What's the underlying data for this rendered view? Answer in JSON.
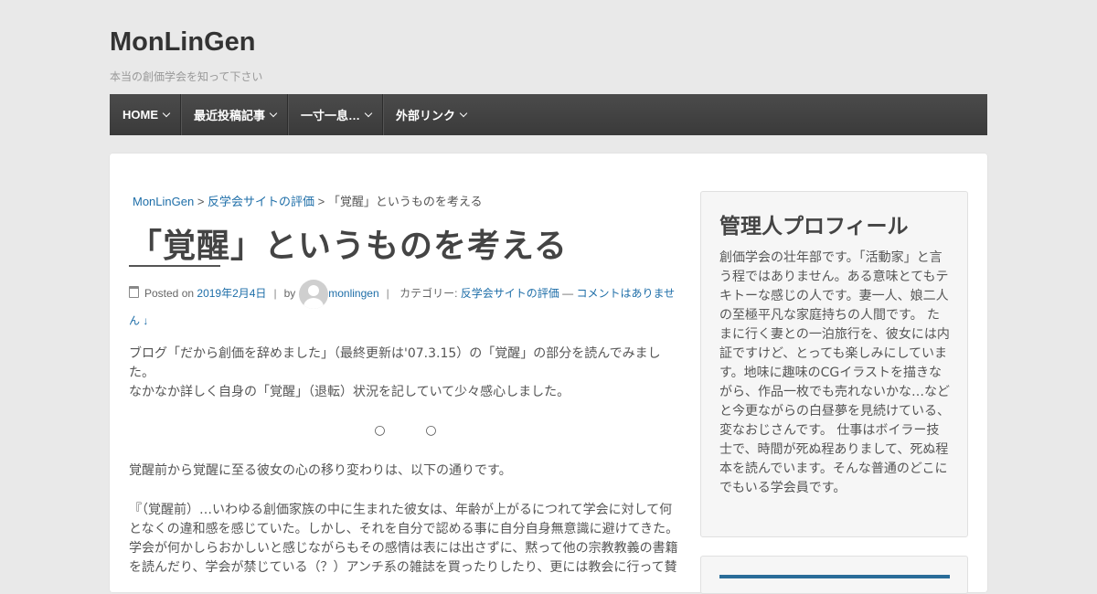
{
  "site": {
    "title": "MonLinGen",
    "tagline": "本当の創価学会を知って下さい"
  },
  "nav": {
    "items": [
      {
        "label": "HOME"
      },
      {
        "label": "最近投稿記事"
      },
      {
        "label": "一寸一息…"
      },
      {
        "label": "外部リンク"
      }
    ]
  },
  "breadcrumb": {
    "home": "MonLinGen",
    "sep1": " > ",
    "category": "反学会サイトの評価",
    "sep2": " > ",
    "current": "「覚醒」というものを考える"
  },
  "post": {
    "title": "「覚醒」というものを考える",
    "posted_on": "Posted on",
    "date": "2019年2月4日",
    "by": "by",
    "author": "monlingen",
    "category_label": "カテゴリー:",
    "category": "反学会サイトの評価",
    "dash": " — ",
    "comments": "コメントはありません ↓",
    "paragraphs": [
      "ブログ「だから創価を辞めました」（最終更新は'07.3.15）の「覚醒」の部分を読んでみました。",
      "なかなか詳しく自身の「覚醒」（退転）状況を記していて少々感心しました。",
      "覚醒前から覚醒に至る彼女の心の移り変わりは、以下の通りです。",
      "『（覚醒前）…いわゆる創価家族の中に生まれた彼女は、年齢が上がるにつれて学会に対して何となくの違和感を感じていた。しかし、それを自分で認める事に自分自身無意識に避けてきた。学会が何かしらおかしいと感じながらもその感情は表には出さずに、黙って他の宗教教義の書籍を読んだり、学会が禁じている（？）アンチ系の雑誌を買ったりしたり、更には教会に行って賛"
    ],
    "mark1": "○",
    "mark2": "○"
  },
  "sidebar": {
    "profile_title": "管理人プロフィール",
    "profile_text": "創価学会の壮年部です。「活動家」と言う程ではありません。ある意味とてもテキトーな感じの人です。妻一人、娘二人の至極平凡な家庭持ちの人間です。 たまに行く妻との一泊旅行を、彼女には内証ですけど、とっても楽しみにしています。地味に趣味のCGイラストを描きながら、作品一枚でも売れないかな…などと今更ながらの白昼夢を見続けている、変なおじさんです。 仕事はボイラー技士で、時間が死ぬ程ありまして、死ぬ程本を読んでいます。そんな普通のどこにでもいる学会員です。"
  },
  "colors": {
    "nav_bg": "#404040",
    "link": "#1e6ea8",
    "page_bg": "#e9e9e9"
  }
}
